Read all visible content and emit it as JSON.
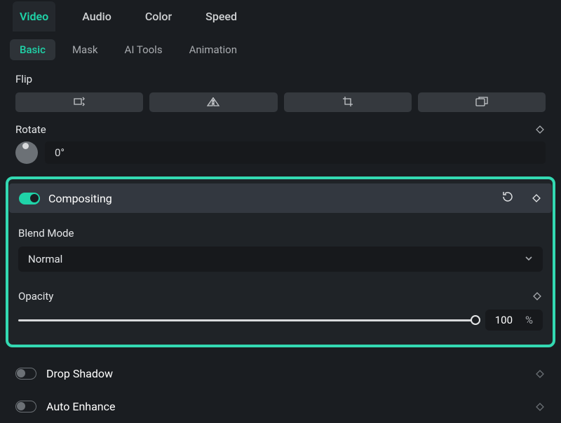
{
  "primaryTabs": {
    "video": "Video",
    "audio": "Audio",
    "color": "Color",
    "speed": "Speed"
  },
  "secondaryTabs": {
    "basic": "Basic",
    "mask": "Mask",
    "aiTools": "AI Tools",
    "animation": "Animation"
  },
  "flip": {
    "label": "Flip"
  },
  "rotate": {
    "label": "Rotate",
    "value": "0°"
  },
  "compositing": {
    "label": "Compositing",
    "blendModeLabel": "Blend Mode",
    "blendModeValue": "Normal",
    "opacityLabel": "Opacity",
    "opacityValue": "100",
    "opacityUnit": "%"
  },
  "dropShadow": {
    "label": "Drop Shadow"
  },
  "autoEnhance": {
    "label": "Auto Enhance"
  }
}
